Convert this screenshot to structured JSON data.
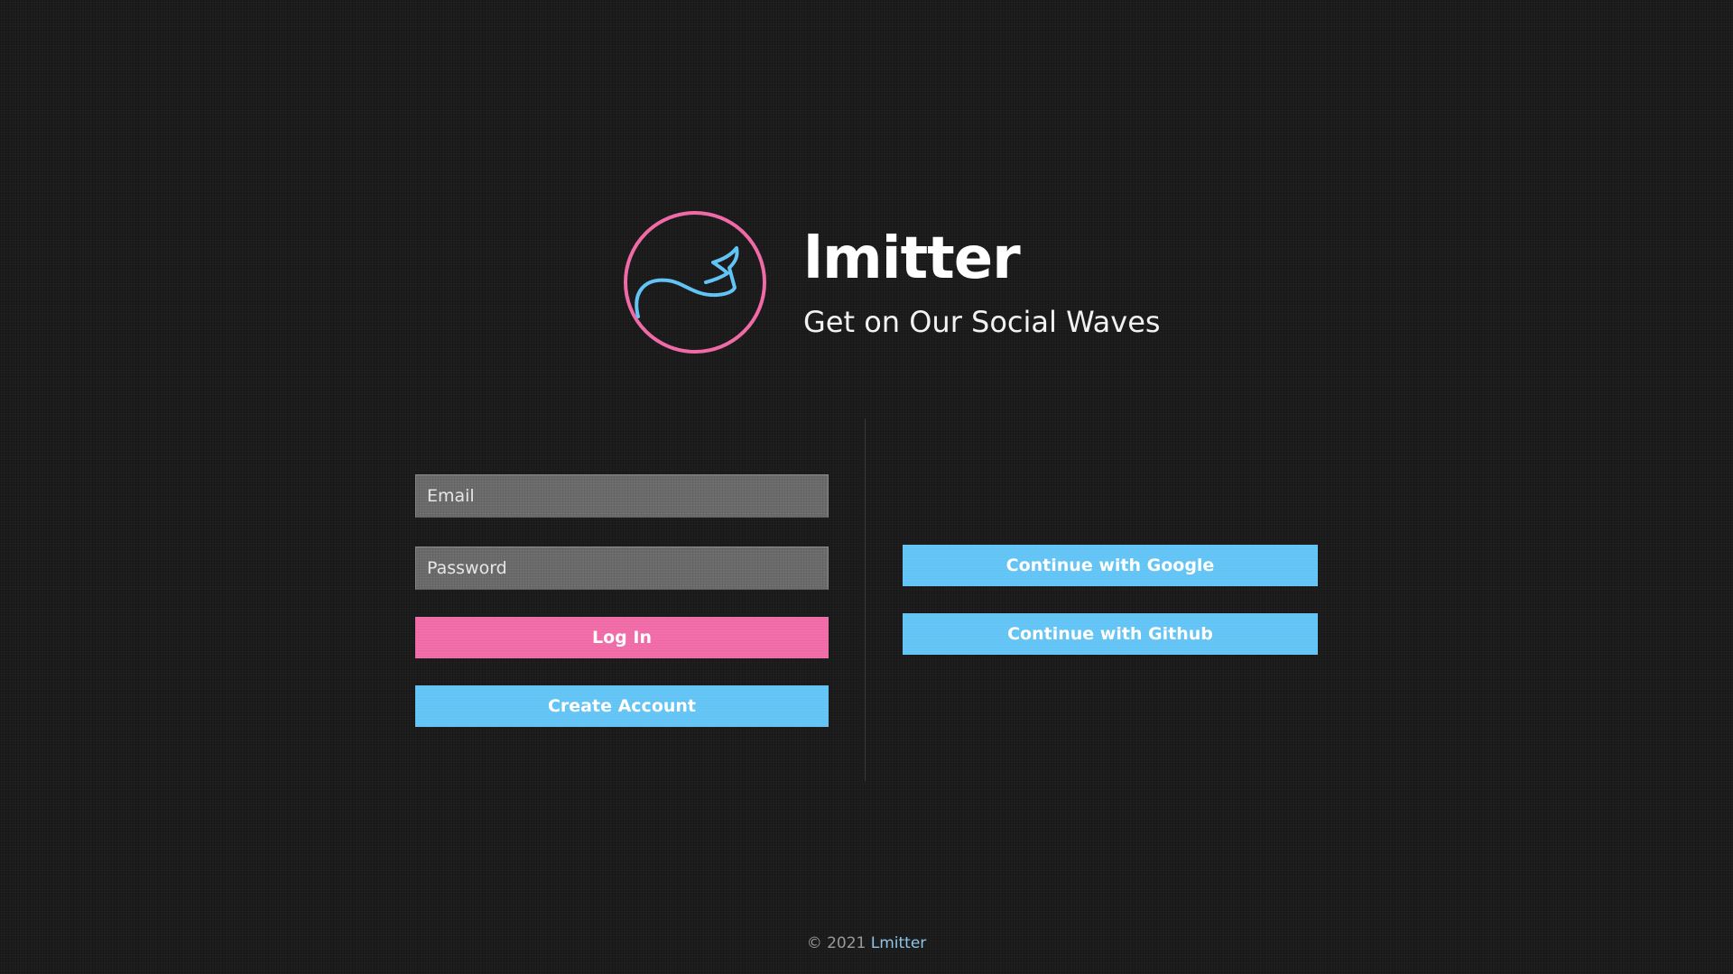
{
  "brand": {
    "title": "lmitter",
    "tagline": "Get on Our Social Waves"
  },
  "login_form": {
    "email_placeholder": "Email",
    "password_placeholder": "Password",
    "login_label": "Log In",
    "create_account_label": "Create Account"
  },
  "social": {
    "google_label": "Continue with Google",
    "github_label": "Continue with Github"
  },
  "footer": {
    "copyright": "© 2021",
    "brand": "Lmitter"
  },
  "icons": {
    "logo": "wave-whale-logo-icon"
  },
  "colors": {
    "background": "#1c1c1c",
    "accent_pink": "#f06aa7",
    "accent_blue": "#62c3f5",
    "field_gray": "#6b6b6b"
  }
}
